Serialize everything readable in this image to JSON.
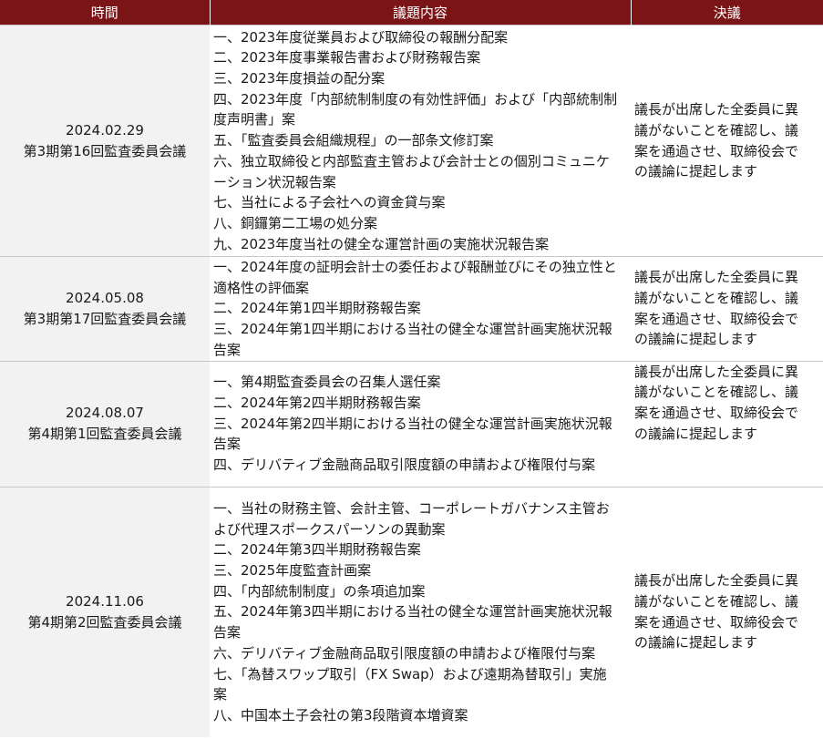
{
  "headers": {
    "time": "時間",
    "agenda": "議題内容",
    "resolution": "決議"
  },
  "resolution_text": "議長が出席した全委員に異議がないことを確認し、議案を通過させ、取締役会での議論に提起します",
  "rows": [
    {
      "date": "2024.02.29",
      "meeting": "第3期第16回監査委員会議",
      "items": [
        "一、2023年度従業員および取締役の報酬分配案",
        "二、2023年度事業報告書および財務報告案",
        "三、2023年度損益の配分案",
        "四、2023年度「内部統制制度の有効性評価」および「内部統制制度声明書」案",
        "五、「監査委員会組織規程」の一部条文修訂案",
        "六、独立取締役と内部監査主管および会計士との個別コミュニケーション状況報告案",
        "七、当社による子会社への資金貸与案",
        "八、銅鑼第二工場の処分案",
        "九、2023年度当社の健全な運営計画の実施状況報告案"
      ]
    },
    {
      "date": "2024.05.08",
      "meeting": "第3期第17回監査委員会議",
      "items": [
        "一、2024年度の証明会計士の委任および報酬並びにその独立性と適格性の評価案",
        "二、2024年第1四半期財務報告案",
        "三、2024年第1四半期における当社の健全な運営計画実施状況報告案"
      ]
    },
    {
      "date": "2024.08.07",
      "meeting": "第4期第1回監査委員会議",
      "items": [
        "一、第4期監査委員会の召集人選任案",
        "二、2024年第2四半期財務報告案",
        "三、2024年第2四半期における当社の健全な運営計画実施状況報告案",
        "四、デリバティブ金融商品取引限度額の申請および権限付与案"
      ]
    },
    {
      "date": "2024.11.06",
      "meeting": "第4期第2回監査委員会議",
      "items": [
        "一、当社の財務主管、会計主管、コーポレートガバナンス主管および代理スポークスパーソンの異動案",
        "二、2024年第3四半期財務報告案",
        "三、2025年度監査計画案",
        "四、「内部統制制度」の条項追加案",
        "五、2024年第3四半期における当社の健全な運営計画実施状況報告案",
        "六、デリバティブ金融商品取引限度額の申請および権限付与案",
        "七、「為替スワップ取引（FX Swap）および遠期為替取引」実施案",
        "八、中国本土子会社の第3段階資本増資案"
      ]
    }
  ]
}
